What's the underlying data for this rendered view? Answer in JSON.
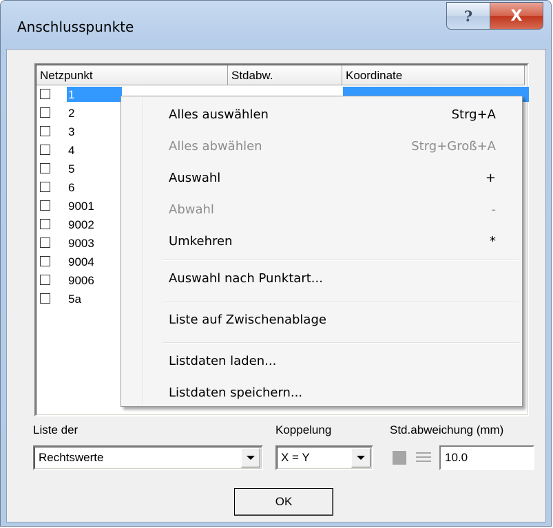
{
  "window": {
    "title": "Anschlusspunkte"
  },
  "titlebar": {
    "help_glyph": "?",
    "close_glyph": "X"
  },
  "list": {
    "columns": [
      "Netzpunkt",
      "Stdabw.",
      "Koordinate"
    ],
    "rows": [
      {
        "id": "1",
        "selected": true
      },
      {
        "id": "2"
      },
      {
        "id": "3"
      },
      {
        "id": "4"
      },
      {
        "id": "5"
      },
      {
        "id": "6"
      },
      {
        "id": "9001"
      },
      {
        "id": "9002"
      },
      {
        "id": "9003"
      },
      {
        "id": "9004"
      },
      {
        "id": "9006"
      },
      {
        "id": "5a"
      }
    ]
  },
  "context_menu": {
    "items": [
      {
        "label": "Alles auswählen",
        "shortcut": "Strg+A",
        "enabled": true
      },
      {
        "label": "Alles abwählen",
        "shortcut": "Strg+Groß+A",
        "enabled": false
      },
      {
        "label": "Auswahl",
        "shortcut": "+",
        "enabled": true
      },
      {
        "label": "Abwahl",
        "shortcut": "-",
        "enabled": false
      },
      {
        "label": "Umkehren",
        "shortcut": "*",
        "enabled": true
      },
      {
        "label": "Auswahl nach Punktart...",
        "shortcut": "",
        "enabled": true
      },
      {
        "label": "Liste auf Zwischenablage",
        "shortcut": "",
        "enabled": true
      },
      {
        "label": "Listdaten laden...",
        "shortcut": "",
        "enabled": true
      },
      {
        "label": "Listdaten speichern...",
        "shortcut": "",
        "enabled": true
      }
    ]
  },
  "controls": {
    "liste_label": "Liste der",
    "liste_value": "Rechtswerte",
    "koppelung_label": "Koppelung",
    "koppelung_value": "X = Y",
    "std_label": "Std.abweichung (mm)",
    "std_value": "10.0",
    "ok_label": "OK"
  },
  "colors": {
    "selection": "#3399ff",
    "title_bar": "#b9cfea",
    "close_button": "#c7391d"
  }
}
